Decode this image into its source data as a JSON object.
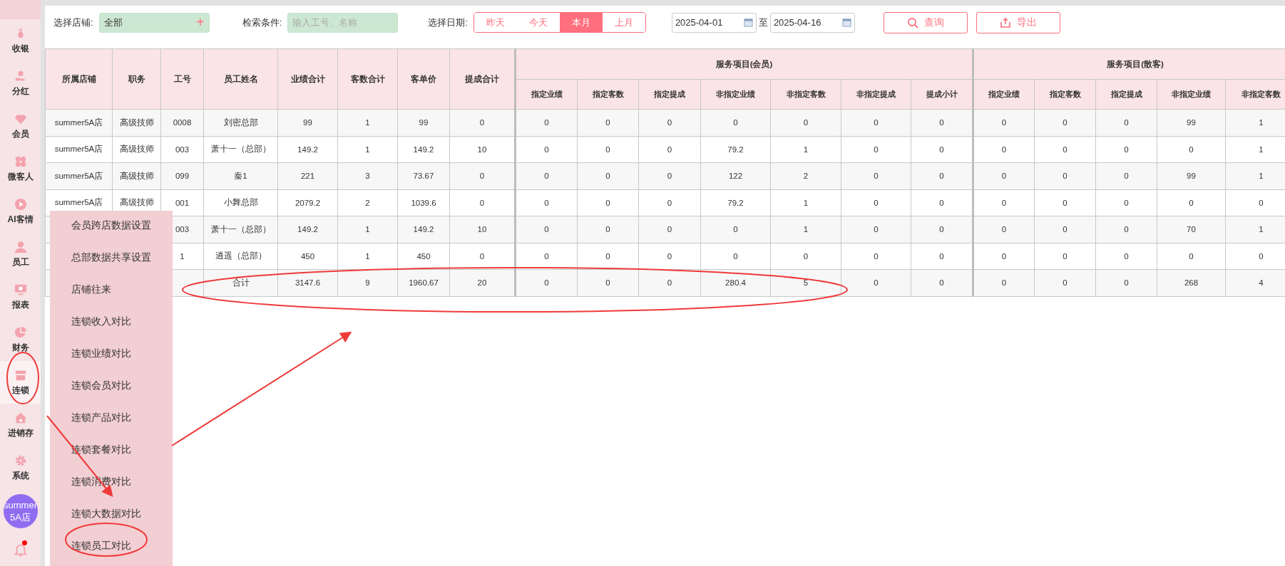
{
  "sidebar": {
    "items": [
      {
        "label": "收银",
        "selected": false
      },
      {
        "label": "分红",
        "selected": false
      },
      {
        "label": "会员",
        "selected": false
      },
      {
        "label": "微客人",
        "selected": false
      },
      {
        "label": "AI客情",
        "selected": false
      },
      {
        "label": "员工",
        "selected": false
      },
      {
        "label": "报表",
        "selected": false
      },
      {
        "label": "财务",
        "selected": false
      },
      {
        "label": "连锁",
        "selected": true
      },
      {
        "label": "进销存",
        "selected": false
      },
      {
        "label": "系统",
        "selected": false
      }
    ],
    "avatar": "summer5A店",
    "notification": {
      "unread": true
    }
  },
  "toolbar": {
    "store_label": "选择店铺:",
    "store_value": "全部",
    "store_add": "+",
    "search_label": "检索条件:",
    "search_placeholder": "输入工号、名称",
    "date_label": "选择日期:",
    "date_ranges": [
      {
        "label": "昨天",
        "selected": false
      },
      {
        "label": "今天",
        "selected": false
      },
      {
        "label": "本月",
        "selected": true
      },
      {
        "label": "上月",
        "selected": false
      }
    ],
    "date_from": "2025-04-01",
    "date_sep": "至",
    "date_to": "2025-04-16",
    "buttons": [
      {
        "kind": "search",
        "label": "查询"
      },
      {
        "kind": "export",
        "label": "导出"
      }
    ]
  },
  "table": {
    "columns": [
      "所属店铺",
      "职务",
      "工号",
      "员工姓名",
      "业绩合计",
      "客数合计",
      "客单价",
      "提成合计"
    ],
    "column_groups": [
      {
        "label": "服务项目(会员)",
        "columns": [
          "指定业绩",
          "指定客数",
          "指定提成",
          "非指定业绩",
          "非指定客数",
          "非指定提成",
          "提成小计"
        ]
      },
      {
        "label": "服务项目(散客)",
        "columns": [
          "指定业绩",
          "指定客数",
          "指定提成",
          "非指定业绩",
          "非指定客数"
        ]
      }
    ],
    "rows": [
      {
        "cells": [
          "summer5A店",
          "高级技师",
          "0008",
          "刘密总部",
          "99",
          "1",
          "99",
          "0",
          "0",
          "0",
          "0",
          "0",
          "0",
          "0",
          "0",
          "0",
          "0",
          "0",
          "99",
          "1"
        ]
      },
      {
        "cells": [
          "summer5A店",
          "高级技师",
          "003",
          "萧十一（总部）",
          "149.2",
          "1",
          "149.2",
          "10",
          "0",
          "0",
          "0",
          "79.2",
          "1",
          "0",
          "0",
          "0",
          "0",
          "0",
          "0",
          "1"
        ]
      },
      {
        "cells": [
          "summer5A店",
          "高级技师",
          "099",
          "秦1",
          "221",
          "3",
          "73.67",
          "0",
          "0",
          "0",
          "0",
          "122",
          "2",
          "0",
          "0",
          "0",
          "0",
          "0",
          "99",
          "1"
        ]
      },
      {
        "cells": [
          "summer5A店",
          "高级技师",
          "001",
          "小舞总部",
          "2079.2",
          "2",
          "1039.6",
          "0",
          "0",
          "0",
          "0",
          "79.2",
          "1",
          "0",
          "0",
          "0",
          "0",
          "0",
          "0",
          "0"
        ]
      },
      {
        "cells": [
          null,
          null,
          "003",
          "萧十一（总部）",
          "149.2",
          "1",
          "149.2",
          "10",
          "0",
          "0",
          "0",
          "0",
          "1",
          "0",
          "0",
          "0",
          "0",
          "0",
          "70",
          "1"
        ]
      },
      {
        "cells": [
          null,
          null,
          "1",
          "逍遥（总部）",
          "450",
          "1",
          "450",
          "0",
          "0",
          "0",
          "0",
          "0",
          "0",
          "0",
          "0",
          "0",
          "0",
          "0",
          "0",
          "0"
        ]
      },
      {
        "cells": [
          null,
          null,
          null,
          "合计",
          "3147.6",
          "9",
          "1960.67",
          "20",
          "0",
          "0",
          "0",
          "280.4",
          "5",
          "0",
          "0",
          "0",
          "0",
          "0",
          "268",
          "4"
        ]
      }
    ]
  },
  "popup_menu": {
    "items": [
      "会员跨店数据设置",
      "总部数据共享设置",
      "店铺往来",
      "连锁收入对比",
      "连锁业绩对比",
      "连锁会员对比",
      "连锁产品对比",
      "连锁套餐对比",
      "连锁消费对比",
      "连锁大数据对比",
      "连锁员工对比"
    ]
  }
}
